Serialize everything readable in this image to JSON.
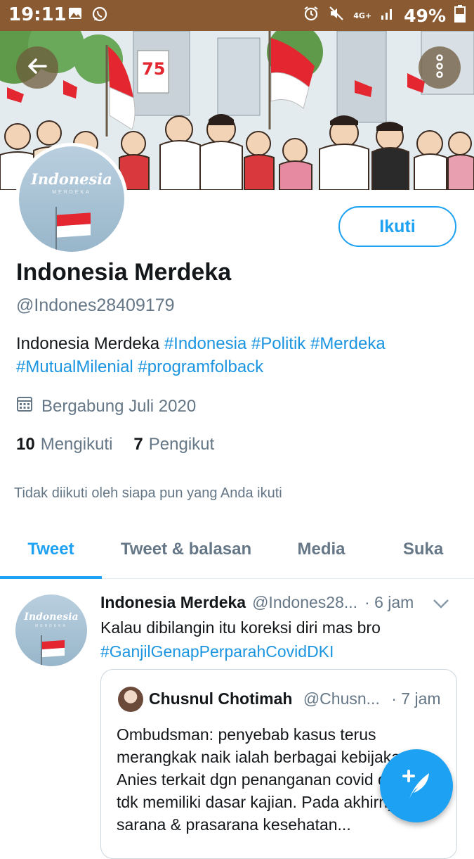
{
  "status_bar": {
    "time": "19:11",
    "network": "4G+",
    "battery": "49%",
    "icons": [
      "image-icon",
      "whatsapp-icon",
      "alarm-icon",
      "mute-icon",
      "signal-icon",
      "battery-icon"
    ]
  },
  "profile": {
    "name": "Indonesia Merdeka",
    "handle": "@Indones28409179",
    "follow_button": "Ikuti",
    "avatar_text": "Indonesia",
    "avatar_subtext": "MERDEKA",
    "bio_text": "Indonesia Merdeka",
    "bio_hashtags": [
      "#Indonesia",
      "#Politik",
      "#Merdeka",
      "#MutualMilenial",
      "#programfolback"
    ],
    "joined": "Bergabung Juli 2020",
    "following_count": "10",
    "following_label": "Mengikuti",
    "followers_count": "7",
    "followers_label": "Pengikut",
    "not_followed_note": "Tidak diikuti oleh siapa pun yang Anda ikuti"
  },
  "tabs": [
    "Tweet",
    "Tweet & balasan",
    "Media",
    "Suka"
  ],
  "tweet": {
    "author": "Indonesia Merdeka",
    "handle": "@Indones28...",
    "time": "· 6 jam",
    "text": "Kalau dibilangin itu koreksi diri mas bro",
    "hashtag": "#GanjilGenapPerparahCovidDKI",
    "quote": {
      "author": "Chusnul Chotimah",
      "handle": "@Chusn...",
      "time": "· 7 jam",
      "text": "Ombudsman: penyebab kasus terus merangkak naik ialah berbagai kebijakan Anies terkait dgn penanganan covid diduga tdk memiliki dasar kajian. Pada akhirnya sarana & prasarana kesehatan..."
    }
  },
  "colors": {
    "accent": "#1da1f2",
    "status_bar": "#8a5a32",
    "text_primary": "#14171a",
    "text_secondary": "#657786"
  }
}
